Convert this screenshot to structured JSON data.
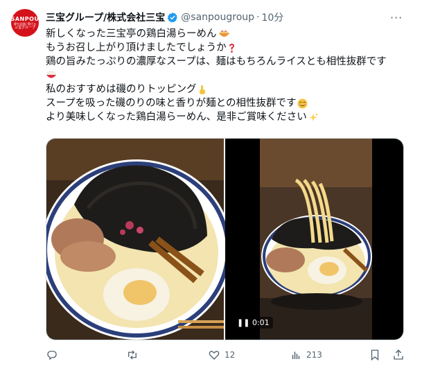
{
  "tweet": {
    "avatar_lines": [
      "SANPOU",
      "夢を笑顔に繋げる",
      "三宝グループ"
    ],
    "display_name": "三宝グループ/株式会社三宝",
    "handle": "@sanpougroup",
    "separator": "·",
    "time": "10分",
    "more_label": "···",
    "lines": [
      "新しくなった三宝亭の鶏白湯らーめん",
      "もうお召し上がり頂けましたでしょうか",
      "鶏の旨みたっぷりの濃厚なスープは、麺はもちろんライスとも相性抜群です",
      "",
      "私のおすすめは磯のりトッピング",
      "スープを吸った磯のりの味と香りが麺との相性抜群です",
      "より美味しくなった鶏白湯らーめん、是非ご賞味ください"
    ],
    "line_emojis": [
      "ramen-bowl",
      "red-question-mark",
      "rice-bowl",
      "",
      "pointing-finger",
      "relieved-face",
      "sparkles"
    ],
    "media": {
      "video_time": "0:01",
      "image_left_icon": "ramen-photo",
      "video_icon": "ramen-video"
    },
    "actions": {
      "reply_count": "",
      "retweet_count": "",
      "like_count": "12",
      "views_count": "213"
    },
    "colors": {
      "accent": "#1d9bf0",
      "brand_red": "#d5121b",
      "muted": "#536471"
    }
  }
}
